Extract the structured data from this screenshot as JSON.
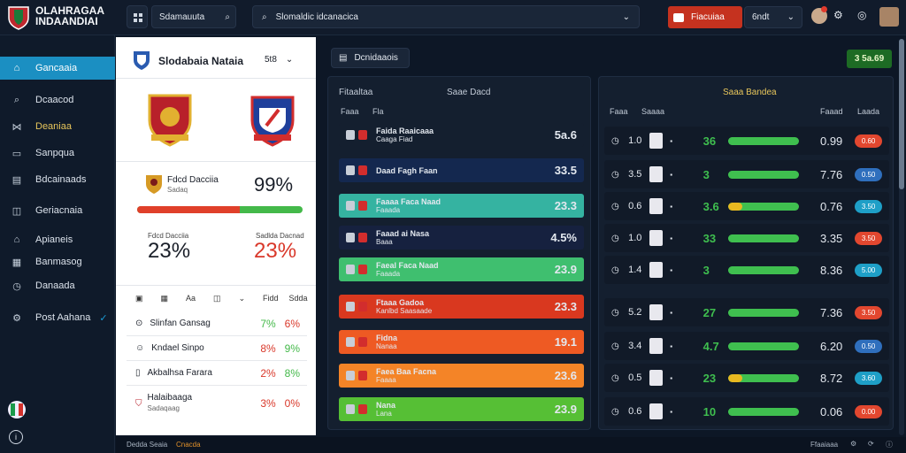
{
  "brand": {
    "line1": "OLAHRAGAA",
    "line2": "INDAANDIAI"
  },
  "topbar": {
    "search1": "Sdamauuta",
    "search2": "Slomaldic idcanacica",
    "live_label": "Fiacuiaa",
    "live_value": "6ndt"
  },
  "sidebar": {
    "items": [
      {
        "label": "Gancaaia",
        "icon": "home-icon"
      },
      {
        "label": "Dcaacod",
        "icon": "search-icon"
      },
      {
        "label": "Deaniaa",
        "icon": "fold-icon"
      },
      {
        "label": "Sanpqua",
        "icon": "monitor-icon"
      },
      {
        "label": "Bdcainaads",
        "icon": "document-icon"
      },
      {
        "label": "Geriacnaia",
        "icon": "bookmark-icon"
      },
      {
        "label": "Apianeis",
        "icon": "home-icon"
      },
      {
        "label": "Banmasog",
        "icon": "grid-icon"
      },
      {
        "label": "Danaada",
        "icon": "clock-icon"
      },
      {
        "label": "Post Aahana",
        "icon": "gear-icon"
      }
    ]
  },
  "team_panel": {
    "title": "Slodabaia Nataia",
    "score": "5t8",
    "label1": "Fdcd Dacciia",
    "label2": "Sadaq",
    "pct": "99%",
    "home_pct": "23%",
    "away_pct": "23%",
    "home_label": "Fdcd Dacciia",
    "away_label": "Sadlda Dacnad",
    "home_split": 0.62,
    "cols": [
      "Aa",
      "Fidd",
      "Sdda"
    ],
    "list": [
      {
        "name": "Slinfan Gansag",
        "a": "7%",
        "b": "6%"
      },
      {
        "name": "Kndael Sinpo",
        "a": "8%",
        "b": "9%"
      },
      {
        "name": "Akbalhsa Farara",
        "a": "2%",
        "b": "8%"
      },
      {
        "name": "Halaibaaga",
        "sub": "Sadaqaag",
        "a": "3%",
        "b": "0%"
      }
    ]
  },
  "mid": {
    "button": "Dcnidaaois",
    "col1": "Fitaaltaa",
    "col2": "Saae Dacd",
    "sub1": "Faaa",
    "sub2": "Fla",
    "rows": [
      {
        "name": "Faida Raaicaaa",
        "sub": "Caaga Fiad",
        "value": "5a.6",
        "color": "#141f2f"
      },
      {
        "name": "Daad Fagh Faan",
        "sub": "",
        "value": "33.5",
        "color": "#14284f"
      },
      {
        "name": "Faaaa Faca Naad",
        "sub": "Faaada",
        "value": "23.3",
        "color": "#35b3a1"
      },
      {
        "name": "Faaad ai Nasa",
        "sub": "Baaa",
        "value": "4.5%",
        "color": "#16213f"
      },
      {
        "name": "Faeal Faca Naad",
        "sub": "Faaada",
        "value": "23.9",
        "color": "#3fbf6f"
      },
      {
        "name": "Ftaaa Gadoa",
        "sub": "Kanlbd Saasaade",
        "value": "23.3",
        "color": "#d9381f"
      },
      {
        "name": "Fidna",
        "sub": "Nanaa",
        "value": "19.1",
        "color": "#ee5a23"
      },
      {
        "name": "Faea Baa Facna",
        "sub": "Faaaa",
        "value": "23.6",
        "color": "#f48427"
      },
      {
        "name": "Nana",
        "sub": "Lana",
        "value": "23.9",
        "color": "#56bf35"
      }
    ]
  },
  "right": {
    "button": "3 5a.69",
    "title": "Saaa Bandea",
    "col1": "Faaa",
    "col2": "Saaaa",
    "col3": "Faaad",
    "col4": "Laada",
    "rows": [
      {
        "a": "1.0",
        "num": "36",
        "bar": 0.95,
        "val": "0.99",
        "pill": "0.60",
        "pc": "#e2472f"
      },
      {
        "a": "3.5",
        "num": "3",
        "bar": 0.95,
        "val": "7.76",
        "pill": "0.50",
        "pc": "#2f6fbd"
      },
      {
        "a": "0.6",
        "num": "3.6",
        "bar": 0.2,
        "val": "0.76",
        "pill": "3.50",
        "pc": "#1e9fc7"
      },
      {
        "a": "1.0",
        "num": "33",
        "bar": 0.95,
        "val": "3.35",
        "pill": "3.50",
        "pc": "#e2472f"
      },
      {
        "a": "1.4",
        "num": "3",
        "bar": 0.95,
        "val": "8.36",
        "pill": "5.00",
        "pc": "#1e9fc7"
      },
      {
        "a": "5.2",
        "num": "27",
        "bar": 0.95,
        "val": "7.36",
        "pill": "3.50",
        "pc": "#e2472f"
      },
      {
        "a": "3.4",
        "num": "4.7",
        "bar": 0.95,
        "val": "6.20",
        "pill": "0.50",
        "pc": "#2f6fbd"
      },
      {
        "a": "0.5",
        "num": "23",
        "bar": 0.2,
        "val": "8.72",
        "pill": "3.60",
        "pc": "#1e9fc7"
      },
      {
        "a": "0.6",
        "num": "10",
        "bar": 0.95,
        "val": "0.06",
        "pill": "0.00",
        "pc": "#e2472f"
      }
    ]
  },
  "statusbar": {
    "left": "Dedda Seaia",
    "mid": "Cnacda",
    "right": "Ffaaiaaa"
  }
}
